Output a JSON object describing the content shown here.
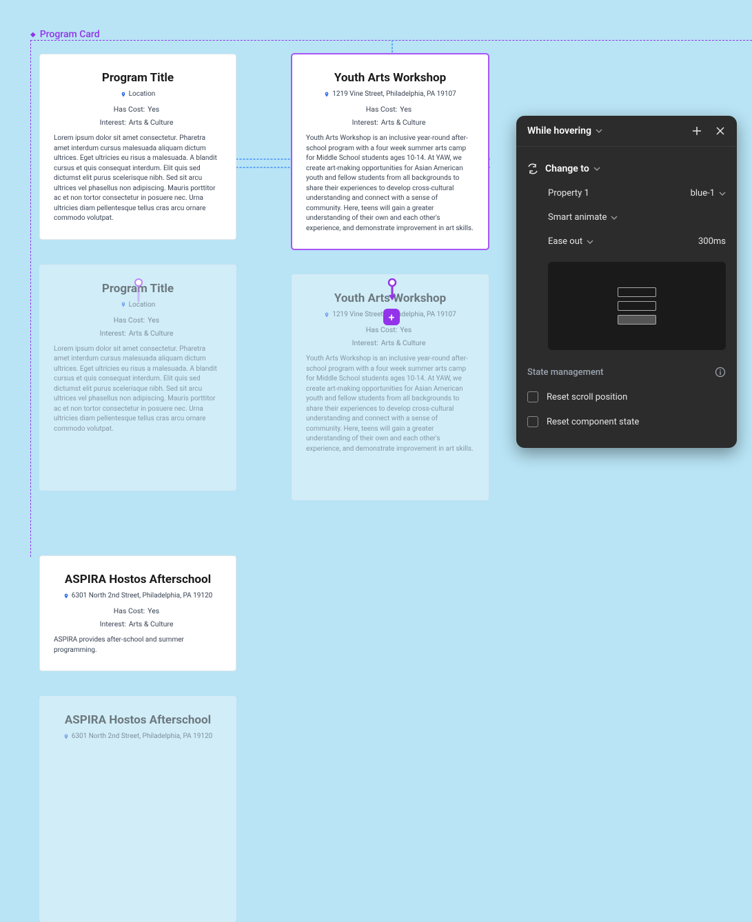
{
  "component_label": "Program Card",
  "cards": [
    {
      "title": "Program Title",
      "location": "Location",
      "has_cost_label": "Has Cost:",
      "has_cost_value": "Yes",
      "interest_label": "Interest:",
      "interest_value": "Arts & Culture",
      "body": "Lorem ipsum dolor sit amet consectetur. Pharetra amet interdum cursus malesuada aliquam dictum ultrices. Eget ultricies eu risus a malesuada. A blandit cursus et quis consequat interdum. Elit quis sed dictumst elit purus scelerisque nibh. Sed sit arcu ultrices vel phasellus non adipiscing. Mauris porttitor ac et non tortor consectetur in posuere nec. Urna ultricies diam pellentesque tellus cras arcu ornare commodo volutpat."
    },
    {
      "title": "Youth Arts Workshop",
      "location": "1219 Vine Street, Philadelphia, PA 19107",
      "has_cost_label": "Has Cost:",
      "has_cost_value": "Yes",
      "interest_label": "Interest:",
      "interest_value": "Arts & Culture",
      "body": "Youth Arts Workshop is an inclusive year-round after-school program with a four week summer arts camp for Middle School students ages 10-14. At YAW, we create art-making opportunities for Asian American youth and fellow students from all backgrounds to share their experiences to develop cross-cultural understanding and connect with a sense of community. Here, teens will gain a greater understanding of their own and each other's experience, and demonstrate improvement in art skills."
    },
    {
      "title": "ASPIRA Hostos Afterschool",
      "location": "6301 North 2nd Street, Philadelphia, PA 19120",
      "has_cost_label": "Has Cost:",
      "has_cost_value": "Yes",
      "interest_label": "Interest:",
      "interest_value": "Arts & Culture",
      "body": "ASPIRA provides after-school and summer programming."
    }
  ],
  "panel": {
    "title": "While hovering",
    "action": "Change to",
    "property_label": "Property 1",
    "property_value": "blue-1",
    "animate_label": "Smart animate",
    "easing": "Ease out",
    "duration": "300ms",
    "state_mgmt_label": "State management",
    "reset_scroll": "Reset scroll position",
    "reset_component": "Reset component state"
  }
}
